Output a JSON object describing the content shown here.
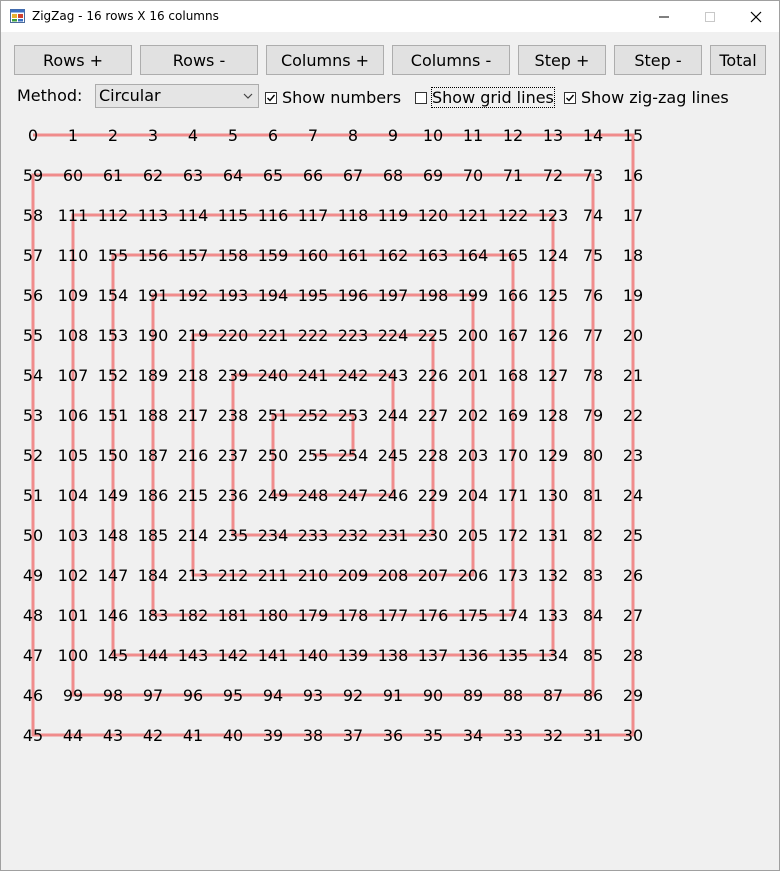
{
  "window": {
    "title": "ZigZag - 16 rows X 16 columns"
  },
  "toolbar": {
    "rows_plus": "Rows +",
    "rows_minus": "Rows -",
    "columns_plus": "Columns +",
    "columns_minus": "Columns -",
    "step_plus": "Step +",
    "step_minus": "Step -",
    "total": "Total"
  },
  "options": {
    "method_label": "Method:",
    "method_value": "Circular",
    "show_numbers_label": "Show numbers",
    "show_numbers_checked": true,
    "show_grid_lines_label": "Show grid lines",
    "show_grid_lines_checked": false,
    "show_zigzag_label": "Show zig-zag lines",
    "show_zigzag_checked": true
  },
  "grid": {
    "rows": 16,
    "columns": 16,
    "method": "circular spiral (clockwise, starting top-left)",
    "line_color": "#f08c8c",
    "text_color": "#000000",
    "numbers": [
      [
        0,
        1,
        2,
        3,
        4,
        5,
        6,
        7,
        8,
        9,
        10,
        11,
        12,
        13,
        14,
        15
      ],
      [
        59,
        60,
        61,
        62,
        63,
        64,
        65,
        66,
        67,
        68,
        69,
        70,
        71,
        72,
        73,
        16
      ],
      [
        58,
        111,
        112,
        113,
        114,
        115,
        116,
        117,
        118,
        119,
        120,
        121,
        122,
        123,
        74,
        17
      ],
      [
        57,
        110,
        155,
        156,
        157,
        158,
        159,
        160,
        161,
        162,
        163,
        164,
        165,
        124,
        75,
        18
      ],
      [
        56,
        109,
        154,
        191,
        192,
        193,
        194,
        195,
        196,
        197,
        198,
        199,
        166,
        125,
        76,
        19
      ],
      [
        55,
        108,
        153,
        190,
        219,
        220,
        221,
        222,
        223,
        224,
        225,
        200,
        167,
        126,
        77,
        20
      ],
      [
        54,
        107,
        152,
        189,
        218,
        239,
        240,
        241,
        242,
        243,
        226,
        201,
        168,
        127,
        78,
        21
      ],
      [
        53,
        106,
        151,
        188,
        217,
        238,
        251,
        252,
        253,
        244,
        227,
        202,
        169,
        128,
        79,
        22
      ],
      [
        52,
        105,
        150,
        187,
        216,
        237,
        250,
        255,
        254,
        245,
        228,
        203,
        170,
        129,
        80,
        23
      ],
      [
        51,
        104,
        149,
        186,
        215,
        236,
        249,
        248,
        247,
        246,
        229,
        204,
        171,
        130,
        81,
        24
      ],
      [
        50,
        103,
        148,
        185,
        214,
        235,
        234,
        233,
        232,
        231,
        230,
        205,
        172,
        131,
        82,
        25
      ],
      [
        49,
        102,
        147,
        184,
        213,
        212,
        211,
        210,
        209,
        208,
        207,
        206,
        173,
        132,
        83,
        26
      ],
      [
        48,
        101,
        146,
        183,
        182,
        181,
        180,
        179,
        178,
        177,
        176,
        175,
        174,
        133,
        84,
        27
      ],
      [
        47,
        100,
        145,
        144,
        143,
        142,
        141,
        140,
        139,
        138,
        137,
        136,
        135,
        134,
        85,
        28
      ],
      [
        46,
        99,
        98,
        97,
        96,
        95,
        94,
        93,
        92,
        91,
        90,
        89,
        88,
        87,
        86,
        29
      ],
      [
        45,
        44,
        43,
        42,
        41,
        40,
        39,
        38,
        37,
        36,
        35,
        34,
        33,
        32,
        31,
        30
      ]
    ]
  }
}
